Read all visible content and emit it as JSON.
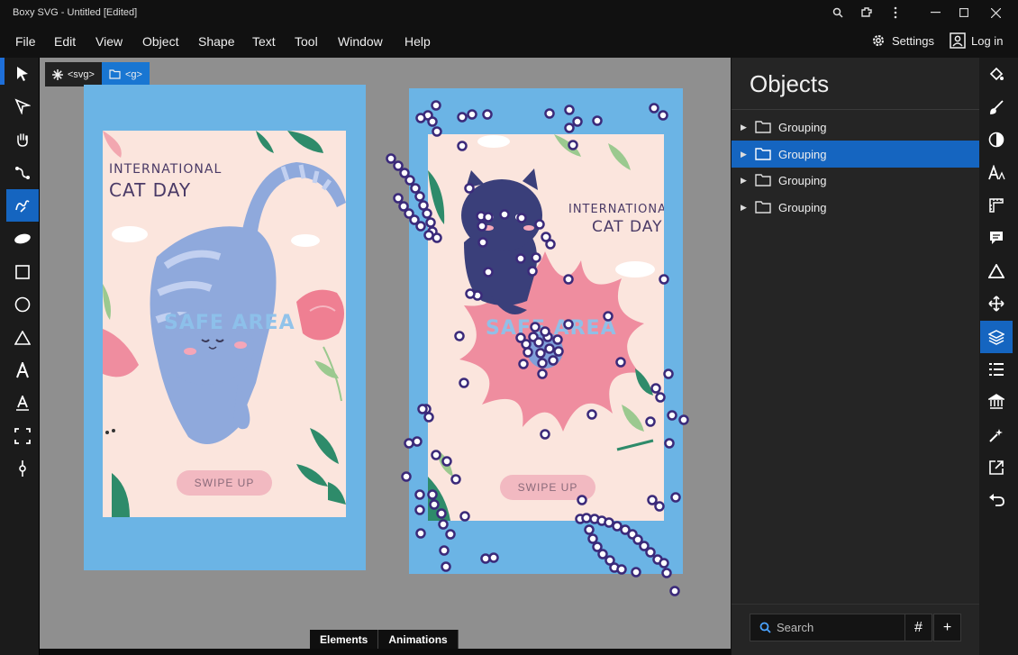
{
  "window": {
    "title": "Boxy SVG - Untitled [Edited]"
  },
  "menu": {
    "items": [
      "File",
      "Edit",
      "View",
      "Object",
      "Shape",
      "Text",
      "Tool",
      "Window",
      "Help"
    ],
    "settings_label": "Settings",
    "login_label": "Log in"
  },
  "breadcrumb": {
    "svg": "<svg>",
    "g": "<g>"
  },
  "artboard_left": {
    "title_line1": "INTERNATIONAL",
    "title_line2": "CAT DAY",
    "safe_area": "SAFE AREA",
    "swipe": "SWIPE UP"
  },
  "artboard_right": {
    "title_line1": "INTERNATIONAL",
    "title_line2": "CAT DAY",
    "safe_area": "SAFE AREA",
    "swipe": "SWIPE UP"
  },
  "bottom_tabs": {
    "elements": "Elements",
    "animations": "Animations"
  },
  "panel": {
    "title": "Objects",
    "objects": [
      {
        "label": "Grouping",
        "selected": false
      },
      {
        "label": "Grouping",
        "selected": true
      },
      {
        "label": "Grouping",
        "selected": false
      },
      {
        "label": "Grouping",
        "selected": false
      }
    ],
    "search_placeholder": "Search",
    "hash_label": "#",
    "add_label": "+"
  },
  "colors": {
    "accent": "#1565c0",
    "canvas": "#8f8f8f",
    "artboard": "#6bb4e5",
    "card": "#fbe5dd"
  }
}
